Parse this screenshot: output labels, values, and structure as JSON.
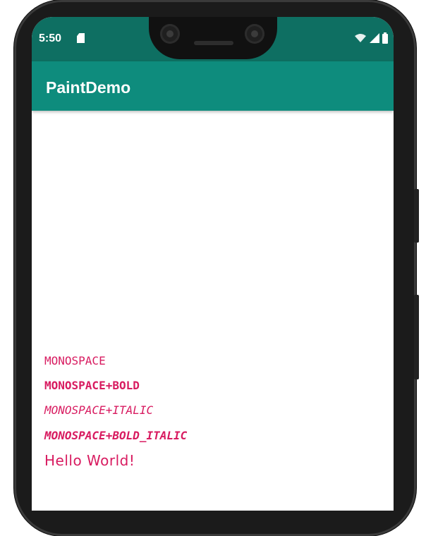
{
  "status_bar": {
    "time": "5:50",
    "icons": [
      "sd-card-icon",
      "wifi-icon",
      "signal-icon",
      "battery-icon"
    ]
  },
  "app_bar": {
    "title": "PaintDemo"
  },
  "canvas": {
    "samples": [
      "MONOSPACE",
      "MONOSPACE+BOLD",
      "MONOSPACE+ITALIC",
      "MONOSPACE+BOLD_ITALIC",
      "Hello World!"
    ]
  },
  "colors": {
    "status_bar": "#0e6f62",
    "app_bar": "#0e8c7d",
    "text_accent": "#d81b60"
  }
}
